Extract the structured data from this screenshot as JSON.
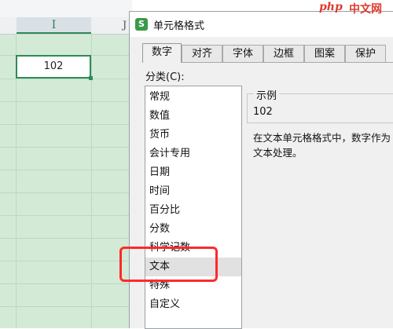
{
  "sheet": {
    "col_i": "I",
    "col_j": "J",
    "active_cell_value": "102"
  },
  "dialog": {
    "title": "单元格格式",
    "app_icon_letter": "S",
    "tabs": [
      "数字",
      "对齐",
      "字体",
      "边框",
      "图案",
      "保护"
    ],
    "active_tab": "数字",
    "category_label": "分类(C):",
    "categories": [
      "常规",
      "数值",
      "货币",
      "会计专用",
      "日期",
      "时间",
      "百分比",
      "分数",
      "科学记数",
      "文本",
      "特殊",
      "自定义"
    ],
    "selected_category": "文本",
    "sample_legend": "示例",
    "sample_value": "102",
    "description": "在文本单元格格式中，数字作为文本处理。"
  },
  "watermark": {
    "brand": "php",
    "site": "中文网"
  },
  "colors": {
    "sheet_bg": "#d3ead6",
    "accent_green": "#2e8b57",
    "highlight_red": "#ff2a2a",
    "dialog_bg": "#f0f0f0"
  }
}
